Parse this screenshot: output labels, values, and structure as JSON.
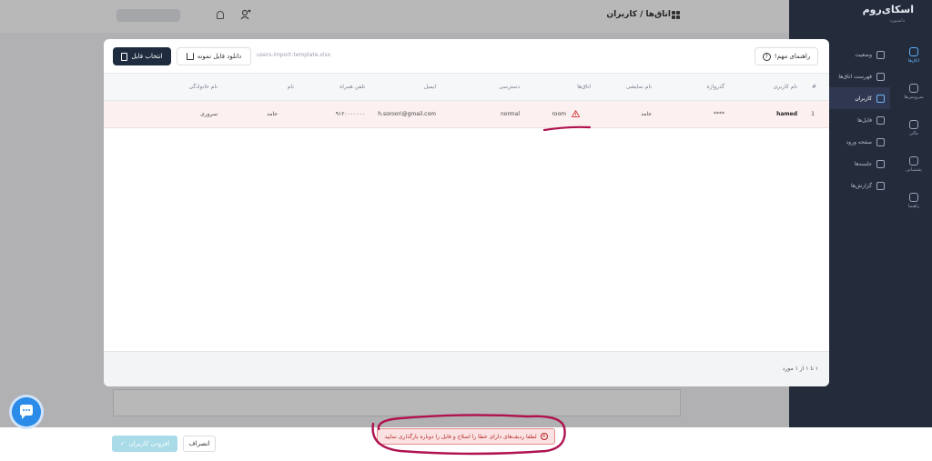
{
  "topbar": {
    "title": "اتاق‌ها / کاربران"
  },
  "sidebar": {
    "logo": "اسکای‌روم",
    "logo_sub": "داشبورد",
    "rail": [
      "اتاق‌ها",
      "سرویس‌ها",
      "مالی",
      "پشتیبانی",
      "راهنما"
    ],
    "menu": [
      "وضعیت",
      "فهرست اتاق‌ها",
      "کاربران",
      "فایل‌ها",
      "صفحه‌ ورود",
      "جلسه‌ها",
      "گزارش‌ها"
    ]
  },
  "modal": {
    "select_file": "انتخاب فایل",
    "download_sample": "دانلود فایل نمونه",
    "file_name": "users-import-template.xlsx",
    "guide": "راهنمای مهم!",
    "columns": [
      "#",
      "نام کاربری",
      "گذرواژه",
      "نام نمایشی",
      "اتاق‌ها",
      "دسترسی",
      "ایمیل",
      "تلفن همراه",
      "نام",
      "نام خانوادگی"
    ],
    "rows": [
      {
        "index": "1",
        "username": "hamed",
        "password": "****",
        "display_name": "حامد",
        "rooms": "room",
        "access": "normal",
        "email": "h.soroori@gmail.com",
        "phone": "۹۱۲۰۰۰۰۰۰۰",
        "first_name": "حامد",
        "last_name": "سروری"
      }
    ],
    "footer": "۱ تا ۱ از ۱ مورد"
  },
  "bottombar": {
    "add_users": "افزودن کاربران",
    "cancel": "انصراف",
    "error_toast": "لطفا ردیف‌های دارای خطا را اصلاح و فایل را دوباره بارگذاری نمایید"
  },
  "colors": {
    "sidebar": "#242b3a",
    "primary_dark": "#1f2b3e",
    "error_row": "#fdf0f0",
    "annotation": "#b0124f",
    "chat": "#2b8be8"
  }
}
